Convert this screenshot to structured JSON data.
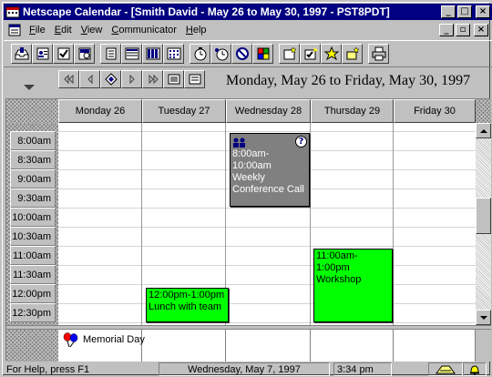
{
  "window": {
    "title": "Netscape Calendar - [Smith David  - May 26  to May 30, 1997 - PST8PDT]",
    "minimize": "_",
    "maximize": "□",
    "close": "×"
  },
  "menu": {
    "items": [
      {
        "label": "File",
        "accel": "F",
        "rest": "ile"
      },
      {
        "label": "Edit",
        "accel": "E",
        "rest": "dit"
      },
      {
        "label": "View",
        "accel": "V",
        "rest": "iew"
      },
      {
        "label": "Communicator",
        "accel": "C",
        "rest": "ommunicator"
      },
      {
        "label": "Help",
        "accel": "H",
        "rest": "elp"
      }
    ],
    "mdi_restore": "▫",
    "mdi_close": "×"
  },
  "toolbar": {
    "buttons": [
      "inbox-icon",
      "address-book-icon",
      "todo-check-icon",
      "agenda-icon",
      "day-view-icon",
      "week-view-icon",
      "month-view-icon",
      "year-view-icon",
      "new-timer-icon",
      "group-timer-icon",
      "cancel-icon",
      "color-grid-icon",
      "new-note-icon",
      "new-task-icon",
      "new-star-icon",
      "new-event-icon",
      "print-icon"
    ]
  },
  "nav": {
    "date_range": "Monday, May 26 to Friday, May 30, 1997",
    "buttons": [
      "first-icon",
      "previous-icon",
      "today-icon",
      "next-icon",
      "last-icon",
      "list-view-icon",
      "details-view-icon"
    ]
  },
  "calendar": {
    "days": [
      {
        "label": "Monday  26"
      },
      {
        "label": "Tuesday  27"
      },
      {
        "label": "Wednesday  28"
      },
      {
        "label": "Thursday  29"
      },
      {
        "label": "Friday  30"
      }
    ],
    "times": [
      "8:00am",
      "8:30am",
      "9:00am",
      "9:30am",
      "10:00am",
      "10:30am",
      "11:00am",
      "11:30am",
      "12:00pm",
      "12:30pm"
    ],
    "appointments": [
      {
        "time": "12:00pm-1:00pm",
        "title": "Lunch with team",
        "color": "#00ff00"
      },
      {
        "time": "8:00am-10:00am",
        "title": "Weekly Conference Call",
        "color": "#808080",
        "help": "?"
      },
      {
        "time": "11:00am-1:00pm",
        "title": "Workshop",
        "color": "#00ff00"
      }
    ],
    "holiday": {
      "label": "Memorial Day"
    }
  },
  "status": {
    "help_text": "For Help, press F1",
    "date": "Wednesday, May 7, 1997",
    "time": "3:34 pm"
  }
}
